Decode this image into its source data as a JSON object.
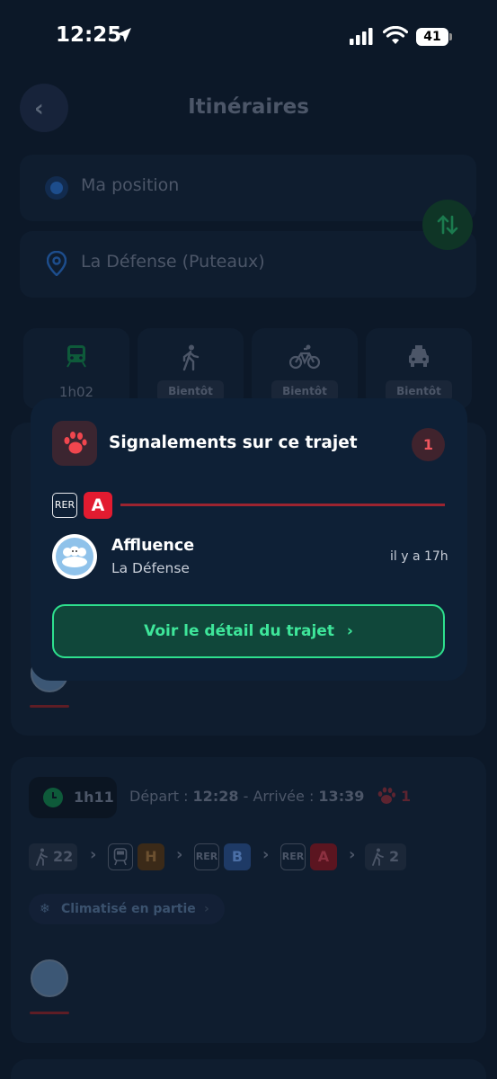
{
  "status_bar": {
    "time": "12:25",
    "battery": "41"
  },
  "header": {
    "title": "Itinéraires"
  },
  "search": {
    "origin": "Ma position",
    "destination": "La Défense (Puteaux)"
  },
  "modes": [
    {
      "name": "transit",
      "label": "1h02"
    },
    {
      "name": "walk",
      "label": "Bientôt"
    },
    {
      "name": "bike",
      "label": "Bientôt"
    },
    {
      "name": "taxi",
      "label": "Bientôt"
    }
  ],
  "popup": {
    "title": "Signalements sur ce trajet",
    "count": "1",
    "line_mode": "RER",
    "line_name": "A",
    "report": {
      "title": "Affluence",
      "station": "La Défense",
      "time_ago": "il y a 17h"
    },
    "button_label": "Voir le détail du trajet"
  },
  "route2": {
    "duration": "1h11",
    "departure_label": "Départ : ",
    "departure_time": "12:28",
    "separator": " - ",
    "arrival_label": "Arrivée : ",
    "arrival_time": "13:39",
    "reports_count": "1",
    "steps": {
      "walk_start": "22",
      "train_line": "H",
      "rer1_mode": "RER",
      "rer1_line": "B",
      "rer2_mode": "RER",
      "rer2_line": "A",
      "walk_end": "2"
    },
    "comfort": "Climatisé en partie"
  },
  "colors": {
    "background": "#0c1828",
    "accent_green": "#2ee08e",
    "rer_a_red": "#e21b30",
    "popup_bg": "#0e2036"
  }
}
